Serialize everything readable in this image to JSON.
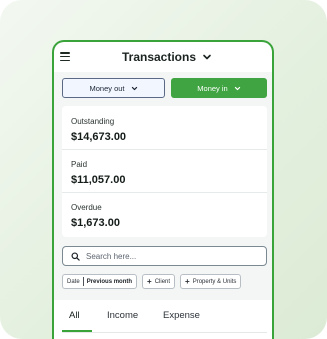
{
  "header": {
    "title": "Transactions"
  },
  "toggle": {
    "money_out": "Money out",
    "money_in": "Money in"
  },
  "summary": {
    "items": [
      {
        "label": "Outstanding",
        "value": "$14,673.00"
      },
      {
        "label": "Paid",
        "value": "$11,057.00"
      },
      {
        "label": "Overdue",
        "value": "$1,673.00"
      }
    ]
  },
  "search": {
    "placeholder": "Search here..."
  },
  "filters": {
    "date_label": "Date",
    "date_value": "Previous month",
    "client": "Client",
    "property": "Property & Units"
  },
  "tabs": {
    "all": "All",
    "income": "Income",
    "expense": "Expense"
  },
  "colors": {
    "accent": "#3aa33a",
    "money_in_bg": "#3fa441",
    "money_out_bg": "#f1f6ff"
  },
  "icons": [
    "hamburger-menu-icon",
    "chevron-down-icon",
    "search-icon",
    "plus-icon"
  ]
}
